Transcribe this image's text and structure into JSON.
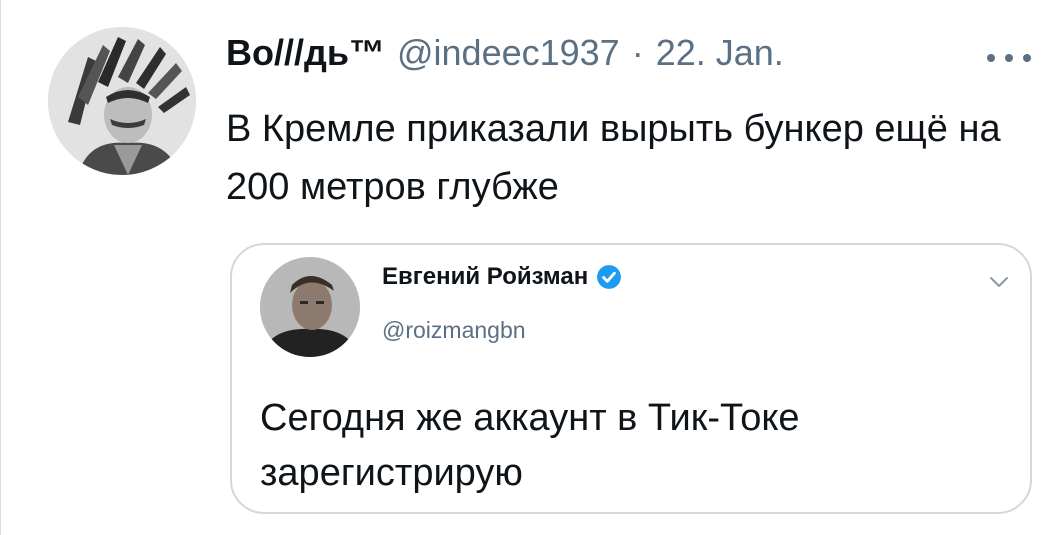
{
  "tweet": {
    "author_name": "Во///дь™",
    "handle": "@indeec1937",
    "separator": "·",
    "date": "22. Jan.",
    "text": "В Кремле приказали вырыть бункер ещё на 200 метров глубже",
    "avatar_icon": "portrait-avatar",
    "more_icon": "more-options-icon"
  },
  "quoted_tweet": {
    "author_name": "Евгений Ройзман",
    "handle": "@roizmangbn",
    "text": "Сегодня же аккаунт в Тик-Токе зарегистрирую",
    "verified_icon": "verified-badge-icon",
    "chevron_icon": "chevron-down-icon",
    "colors": {
      "verified": "#1d9bf0"
    }
  },
  "colors": {
    "text_primary": "#0f1419",
    "text_secondary": "#5b7083",
    "border": "#cfd9de"
  }
}
